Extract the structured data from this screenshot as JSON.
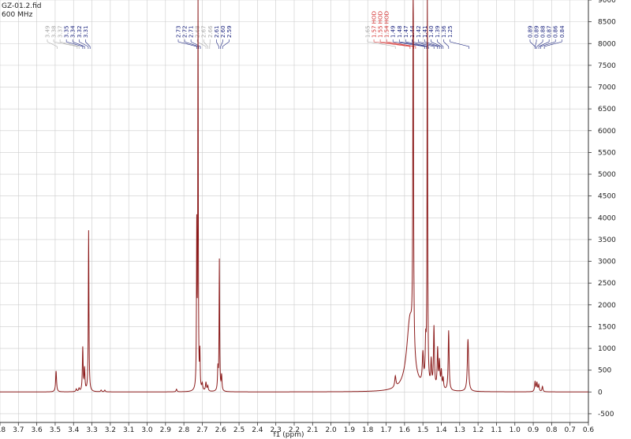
{
  "header": {
    "filename": "GZ-01.2.fid",
    "frequency": "600 MHz"
  },
  "colors": {
    "spectrum": "#8b1a1a",
    "label_dark": "#1a237e",
    "label_gray": "#a8a8a8",
    "label_red": "#d32f2f",
    "grid": "#cccccc"
  },
  "chart_data": {
    "type": "line",
    "xlabel": "f1 (ppm)",
    "ylabel": "",
    "title": "",
    "x_reversed": true,
    "xlim": [
      0.6,
      3.8
    ],
    "ylim": [
      -700,
      9000
    ],
    "grid": true,
    "x_ticks": [
      3.8,
      3.7,
      3.6,
      3.5,
      3.4,
      3.3,
      3.2,
      3.1,
      3.0,
      2.9,
      2.8,
      2.7,
      2.6,
      2.5,
      2.4,
      2.3,
      2.2,
      2.1,
      2.0,
      1.9,
      1.8,
      1.7,
      1.6,
      1.5,
      1.4,
      1.3,
      1.2,
      1.1,
      1.0,
      0.9,
      0.8,
      0.7,
      0.6
    ],
    "x_tick_labels": [
      "3.8",
      "3.7",
      "3.6",
      "3.5",
      "3.4",
      "3.3",
      "3.2",
      "3.1",
      "3.0",
      "2.9",
      "2.8",
      "2.7",
      "2.6",
      "2.5",
      "2.4",
      "2.3",
      "2.2",
      "2.1",
      "2.0",
      "1.9",
      "1.8",
      "1.7",
      "1.6",
      "1.5",
      "1.4",
      "1.3",
      "1.2",
      "1.1",
      "1.0",
      "0.9",
      "0.8",
      "0.7",
      "0.6"
    ],
    "y_ticks": [
      -500,
      0,
      500,
      1000,
      1500,
      2000,
      2500,
      3000,
      3500,
      4000,
      4500,
      5000,
      5500,
      6000,
      6500,
      7000,
      7500,
      8000,
      8500,
      9000
    ],
    "y_tick_labels": [
      "-500",
      "0",
      "500",
      "1000",
      "1500",
      "2000",
      "2500",
      "3000",
      "3500",
      "4000",
      "4500",
      "5000",
      "5500",
      "6000",
      "6500",
      "7000",
      "7500",
      "8000",
      "8500",
      "9000"
    ],
    "peaks": [
      {
        "ppm": 3.495,
        "height": 480,
        "width": 0.003
      },
      {
        "ppm": 3.385,
        "height": 60,
        "width": 0.003
      },
      {
        "ppm": 3.37,
        "height": 70,
        "width": 0.003
      },
      {
        "ppm": 3.35,
        "height": 1000,
        "width": 0.0025
      },
      {
        "ppm": 3.34,
        "height": 500,
        "width": 0.0025
      },
      {
        "ppm": 3.318,
        "height": 3700,
        "width": 0.002
      },
      {
        "ppm": 3.25,
        "height": 40,
        "width": 0.003
      },
      {
        "ppm": 3.23,
        "height": 40,
        "width": 0.003
      },
      {
        "ppm": 2.84,
        "height": 60,
        "width": 0.003
      },
      {
        "ppm": 2.73,
        "height": 3650,
        "width": 0.0018
      },
      {
        "ppm": 2.723,
        "height": 9500,
        "width": 0.0015
      },
      {
        "ppm": 2.713,
        "height": 800,
        "width": 0.0018
      },
      {
        "ppm": 2.7,
        "height": 150,
        "width": 0.003
      },
      {
        "ppm": 2.68,
        "height": 200,
        "width": 0.003
      },
      {
        "ppm": 2.67,
        "height": 120,
        "width": 0.003
      },
      {
        "ppm": 2.615,
        "height": 500,
        "width": 0.0025
      },
      {
        "ppm": 2.607,
        "height": 3000,
        "width": 0.0018
      },
      {
        "ppm": 2.595,
        "height": 350,
        "width": 0.0025
      },
      {
        "ppm": 1.65,
        "height": 250,
        "width": 0.004
      },
      {
        "ppm": 1.57,
        "height": 1650,
        "width": 0.022
      },
      {
        "ppm": 1.553,
        "height": 9500,
        "width": 0.002
      },
      {
        "ppm": 1.5,
        "height": 700,
        "width": 0.004
      },
      {
        "ppm": 1.485,
        "height": 900,
        "width": 0.003
      },
      {
        "ppm": 1.476,
        "height": 9500,
        "width": 0.0018
      },
      {
        "ppm": 1.455,
        "height": 600,
        "width": 0.003
      },
      {
        "ppm": 1.44,
        "height": 1400,
        "width": 0.003
      },
      {
        "ppm": 1.42,
        "height": 900,
        "width": 0.003
      },
      {
        "ppm": 1.41,
        "height": 600,
        "width": 0.003
      },
      {
        "ppm": 1.4,
        "height": 400,
        "width": 0.003
      },
      {
        "ppm": 1.39,
        "height": 250,
        "width": 0.003
      },
      {
        "ppm": 1.36,
        "height": 1380,
        "width": 0.003
      },
      {
        "ppm": 1.255,
        "height": 1200,
        "width": 0.004
      },
      {
        "ppm": 0.89,
        "height": 230,
        "width": 0.003
      },
      {
        "ppm": 0.88,
        "height": 200,
        "width": 0.003
      },
      {
        "ppm": 0.87,
        "height": 150,
        "width": 0.003
      },
      {
        "ppm": 0.85,
        "height": 120,
        "width": 0.003
      }
    ],
    "peak_label_groups": [
      {
        "labels": [
          {
            "text": "3.49",
            "color": "gray"
          },
          {
            "text": "3.38",
            "color": "gray"
          },
          {
            "text": "3.37",
            "color": "gray"
          },
          {
            "text": "3.35",
            "color": "dark"
          },
          {
            "text": "3.34",
            "color": "dark"
          },
          {
            "text": "3.32",
            "color": "dark"
          },
          {
            "text": "3.31",
            "color": "dark"
          }
        ]
      },
      {
        "labels": [
          {
            "text": "2.73",
            "color": "dark"
          },
          {
            "text": "2.72",
            "color": "dark"
          },
          {
            "text": "2.71",
            "color": "dark"
          },
          {
            "text": "2.68",
            "color": "gray"
          },
          {
            "text": "2.67",
            "color": "gray"
          },
          {
            "text": "2.66",
            "color": "gray"
          },
          {
            "text": "2.61",
            "color": "dark"
          },
          {
            "text": "2.60",
            "color": "dark"
          },
          {
            "text": "2.59",
            "color": "dark"
          }
        ]
      },
      {
        "labels": [
          {
            "text": "1.65",
            "color": "gray"
          },
          {
            "text": "1.57 HOD",
            "color": "red"
          },
          {
            "text": "1.55 HOD",
            "color": "red"
          },
          {
            "text": "1.54 HOD",
            "color": "red"
          },
          {
            "text": "1.49",
            "color": "dark"
          },
          {
            "text": "1.48",
            "color": "dark"
          },
          {
            "text": "1.47",
            "color": "dark"
          },
          {
            "text": "1.44",
            "color": "dark"
          },
          {
            "text": "1.42",
            "color": "dark"
          },
          {
            "text": "1.41",
            "color": "dark"
          },
          {
            "text": "1.40",
            "color": "dark"
          },
          {
            "text": "1.39",
            "color": "dark"
          },
          {
            "text": "1.36",
            "color": "dark"
          },
          {
            "text": "1.25",
            "color": "dark"
          }
        ]
      },
      {
        "labels": [
          {
            "text": "0.89",
            "color": "dark"
          },
          {
            "text": "0.89",
            "color": "dark"
          },
          {
            "text": "0.88",
            "color": "dark"
          },
          {
            "text": "0.87",
            "color": "dark"
          },
          {
            "text": "0.86",
            "color": "dark"
          },
          {
            "text": "0.84",
            "color": "dark"
          }
        ]
      }
    ]
  }
}
